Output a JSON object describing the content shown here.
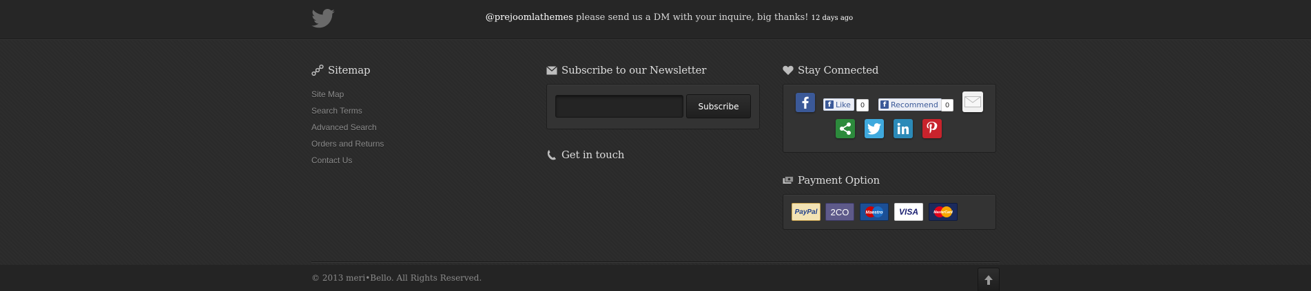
{
  "twitter": {
    "handle": "@prejoomlathemes",
    "message": " please send us a DM with your inquire, big thanks! ",
    "time_ago": "12 days ago"
  },
  "sitemap": {
    "title": "Sitemap",
    "links": [
      "Site Map",
      "Search Terms",
      "Advanced Search",
      "Orders and Returns",
      "Contact Us"
    ]
  },
  "newsletter": {
    "title": "Subscribe to our Newsletter",
    "input_value": "",
    "button_label": "Subscribe"
  },
  "contact": {
    "title": "Get in touch"
  },
  "social": {
    "title": "Stay Connected",
    "like_label": "Like",
    "like_count": "0",
    "recommend_label": "Recommend",
    "recommend_count": "0",
    "fb_letter": "f",
    "icons": [
      "facebook-icon",
      "email-icon",
      "share-icon",
      "twitter-icon",
      "linkedin-icon",
      "pinterest-icon"
    ],
    "colors": {
      "facebook": "#3b5998",
      "share": "#2c8a3c",
      "twitter": "#3fa9dd",
      "linkedin": "#2b8ab8",
      "pinterest": "#c8232c"
    }
  },
  "payment": {
    "title": "Payment Option",
    "cards": [
      "PayPal",
      "2CO",
      "Maestro",
      "VISA",
      "MasterCard"
    ]
  },
  "footer": {
    "copyright": "© 2013 meri•Bello. All Rights Reserved."
  }
}
